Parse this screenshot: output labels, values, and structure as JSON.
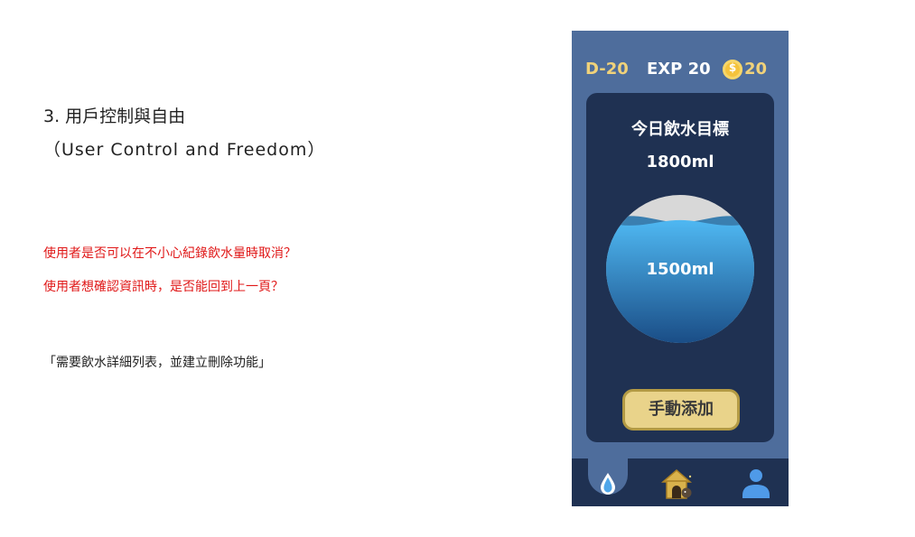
{
  "slide": {
    "heading": "3. 用戶控制與自由",
    "subheading": "（User Control and Freedom）",
    "question_1": "使用者是否可以在不小心紀錄飲水量時取消？",
    "question_2": "使用者想確認資訊時，是否能回到上一頁？",
    "quote": "「需要飲水詳細列表，並建立刪除功能」",
    "question_color": "#e01818"
  },
  "app": {
    "status": {
      "day": "D-20",
      "exp": "EXP 20",
      "coins": "20",
      "coin_icon": "coin-icon"
    },
    "card": {
      "title": "今日飲水目標",
      "goal": "1800ml",
      "current": "1500ml",
      "fill_fraction": 0.83,
      "add_button_label": "手動添加"
    },
    "nav": {
      "items": [
        {
          "name": "water",
          "icon": "water-drop-icon",
          "active": true
        },
        {
          "name": "home",
          "icon": "doghouse-icon",
          "active": false
        },
        {
          "name": "profile",
          "icon": "user-icon",
          "active": false
        }
      ]
    },
    "colors": {
      "phone_bg": "#4e6d9c",
      "card_bg": "#1f3152",
      "gold": "#f0d27a",
      "water_light": "#4fb8f2",
      "water_dark": "#1a4d86",
      "button_bg": "#e9d38a"
    }
  }
}
